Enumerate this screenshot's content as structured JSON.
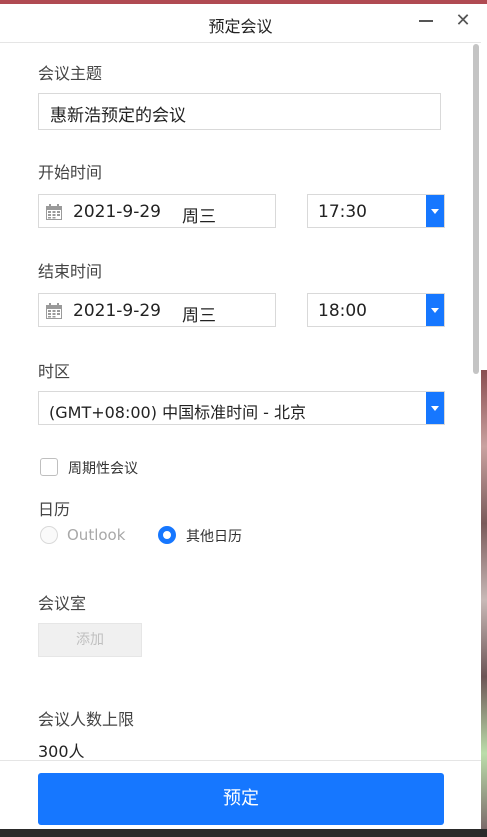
{
  "window": {
    "title": "预定会议"
  },
  "subject": {
    "label": "会议主题",
    "value": "惠新浩预定的会议"
  },
  "start": {
    "label": "开始时间",
    "date": "2021-9-29",
    "weekday": "周三",
    "time": "17:30"
  },
  "end": {
    "label": "结束时间",
    "date": "2021-9-29",
    "weekday": "周三",
    "time": "18:00"
  },
  "timezone": {
    "label": "时区",
    "value": "(GMT+08:00) 中国标准时间 - 北京"
  },
  "recurring": {
    "label": "周期性会议",
    "checked": false
  },
  "calendar": {
    "label": "日历",
    "options": [
      {
        "label": "Outlook",
        "selected": false,
        "enabled": false
      },
      {
        "label": "其他日历",
        "selected": true,
        "enabled": true
      }
    ]
  },
  "room": {
    "label": "会议室",
    "add_label": "添加"
  },
  "capacity": {
    "label": "会议人数上限",
    "value": "300人"
  },
  "submit_label": "预定",
  "colors": {
    "accent": "#1677ff",
    "border": "#d9d9d9"
  }
}
